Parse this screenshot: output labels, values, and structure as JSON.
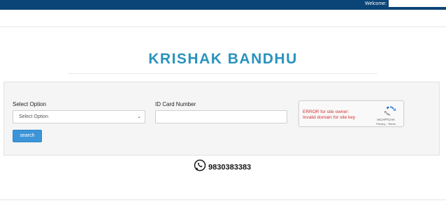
{
  "header": {
    "welcome_label": "Welcome:",
    "bar_color": "#0b4476"
  },
  "brand": {
    "title": "KRISHAK BANDHU",
    "color": "#2a93bd"
  },
  "form": {
    "select_label": "Select Option",
    "select_value": "Select Option",
    "id_label": "ID Card Number",
    "id_value": "",
    "search_label": "search",
    "search_color": "#3b95d8"
  },
  "recaptcha": {
    "error_line1": "ERROR for site owner:",
    "error_line2": "Invalid domain for site key",
    "label": "reCAPTCHA",
    "links": "Privacy - Terms",
    "icon": "recaptcha-logo"
  },
  "contact": {
    "icon": "whatsapp-icon",
    "phone": "9830383383"
  }
}
